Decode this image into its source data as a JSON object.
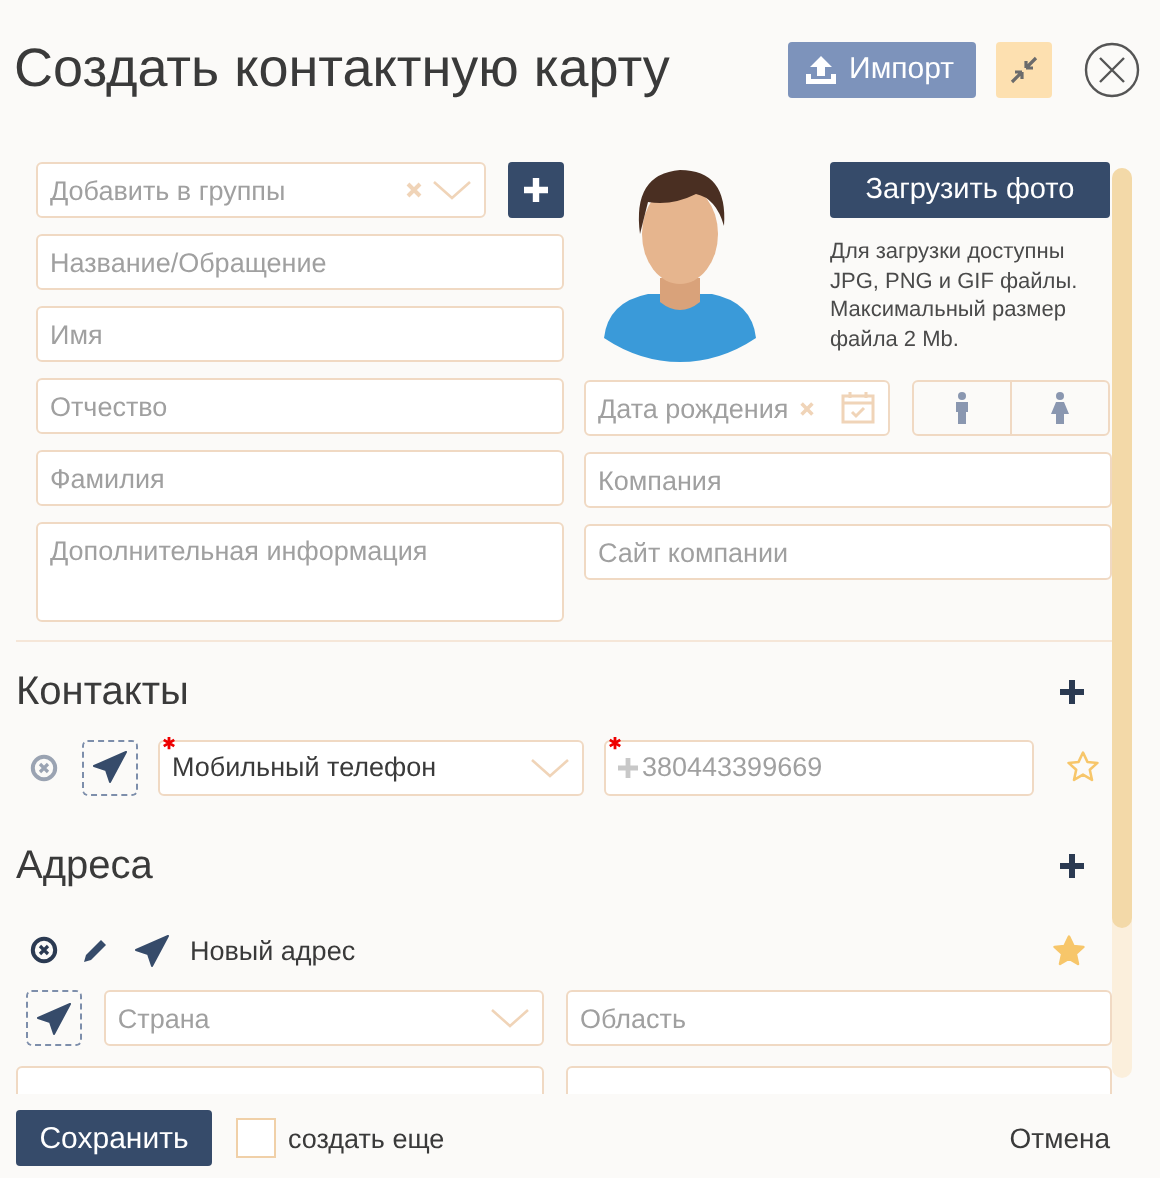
{
  "header": {
    "title": "Создать контактную карту",
    "import_button": "Импорт"
  },
  "groups_field": {
    "placeholder": "Добавить в группы"
  },
  "left_fields": [
    {
      "kind": "input",
      "placeholder": "Название/Обращение"
    },
    {
      "kind": "input",
      "placeholder": "Имя"
    },
    {
      "kind": "input",
      "placeholder": "Отчество"
    },
    {
      "kind": "input",
      "placeholder": "Фамилия"
    },
    {
      "kind": "textarea",
      "placeholder": "Дополнительная информация"
    }
  ],
  "upload_button": "Загрузить фото",
  "upload_hint": [
    "Для загрузки доступны",
    "JPG, PNG и GIF файлы.",
    "Максимальный размер",
    "файла 2 Mb."
  ],
  "birth_date": {
    "placeholder": "Дата рождения"
  },
  "gender": [
    {
      "kind": "male",
      "selected": false
    },
    {
      "kind": "female",
      "selected": false
    }
  ],
  "right_fields": [
    {
      "placeholder": "Компания"
    },
    {
      "placeholder": "Сайт компании"
    }
  ],
  "contacts": {
    "title": "Контакты",
    "items": [
      {
        "type": "Мобильный телефон",
        "type_required": true,
        "placeholder": "380443399669",
        "number_required": true,
        "favorite": false
      }
    ]
  },
  "addresses": {
    "title": "Адреса",
    "items": [
      {
        "name": "Новый адрес",
        "favorite": true,
        "country_placeholder": "Страна",
        "region_placeholder": "Область"
      }
    ]
  },
  "footer": {
    "save_button": "Сохранить",
    "create_more": {
      "label": "создать еще",
      "checked": false
    },
    "cancel": "Отмена"
  }
}
